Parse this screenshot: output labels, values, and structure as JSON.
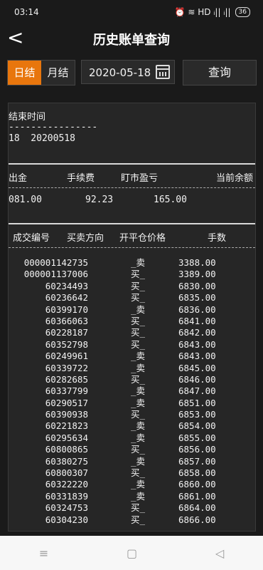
{
  "status": {
    "time": "03:14",
    "icons": "⏰ ≋ HD ᵢ|| ᵢ||",
    "battery": "36"
  },
  "header": {
    "back": "<",
    "title": "历史账单查询"
  },
  "toolbar": {
    "daily": "日结",
    "monthly": "月结",
    "date": "2020-05-18",
    "query": "查询"
  },
  "report": {
    "end_time_label": "结束时间",
    "dashes": "----------------",
    "end_time_value": "18  20200518",
    "cols": [
      "出金",
      "手续费",
      "盯市盈亏",
      "当前余额"
    ],
    "vals": [
      "081.00",
      "92.23",
      "165.00"
    ],
    "trade_headers": [
      "成交编号",
      "买卖方向",
      "开平仓价格",
      "手数"
    ],
    "trades": [
      [
        "000001142735",
        "_卖",
        "3388.00"
      ],
      [
        "000001137006",
        "买_",
        "3389.00"
      ],
      [
        "60234493",
        "买_",
        "6830.00"
      ],
      [
        "60236642",
        "买_",
        "6835.00"
      ],
      [
        "60399170",
        "_卖",
        "6836.00"
      ],
      [
        "60366063",
        "买_",
        "6841.00"
      ],
      [
        "60228187",
        "买_",
        "6842.00"
      ],
      [
        "60352798",
        "买_",
        "6843.00"
      ],
      [
        "60249961",
        "_卖",
        "6843.00"
      ],
      [
        "60339722",
        "_卖",
        "6845.00"
      ],
      [
        "60282685",
        "买_",
        "6846.00"
      ],
      [
        "60337799",
        "_卖",
        "6847.00"
      ],
      [
        "60290517",
        "_卖",
        "6851.00"
      ],
      [
        "60390938",
        "买_",
        "6853.00"
      ],
      [
        "60221823",
        "_卖",
        "6854.00"
      ],
      [
        "60295634",
        "_卖",
        "6855.00"
      ],
      [
        "60800865",
        "买_",
        "6856.00"
      ],
      [
        "60380275",
        "_卖",
        "6857.00"
      ],
      [
        "60800307",
        "买_",
        "6858.00"
      ],
      [
        "60322220",
        "_卖",
        "6860.00"
      ],
      [
        "60331839",
        "_卖",
        "6861.00"
      ],
      [
        "60324753",
        "买_",
        "6864.00"
      ],
      [
        "60304230",
        "买_",
        "6866.00"
      ]
    ]
  },
  "nav": {
    "menu": "≡",
    "home": "▢",
    "back": "◁"
  }
}
